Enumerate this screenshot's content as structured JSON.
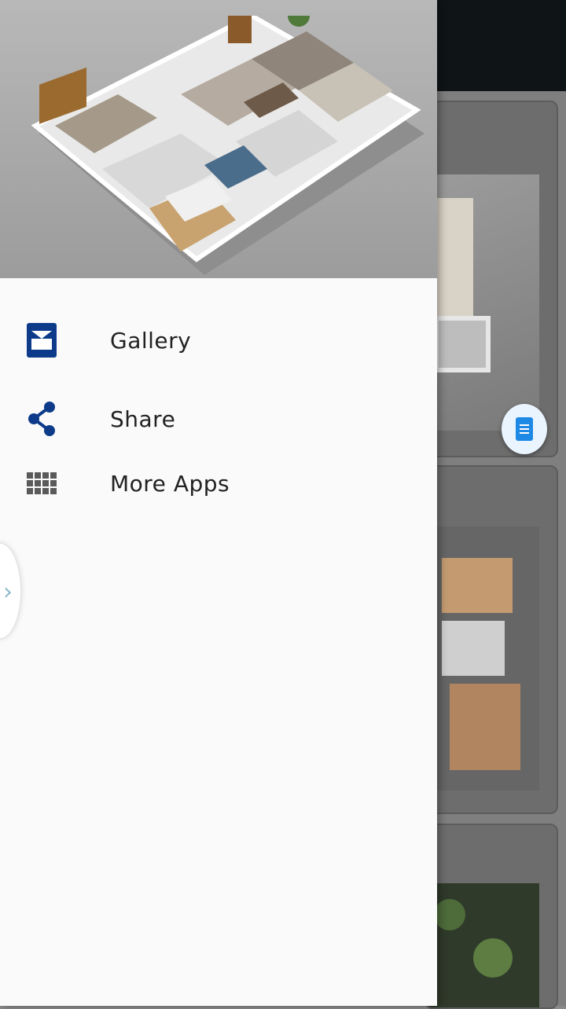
{
  "drawer": {
    "menu": [
      {
        "key": "gallery",
        "label": "Gallery",
        "icon": "gallery-icon"
      },
      {
        "key": "share",
        "label": "Share",
        "icon": "share-icon"
      },
      {
        "key": "more_apps",
        "label": "More Apps",
        "icon": "apps-grid-icon"
      }
    ]
  },
  "colors": {
    "icon_accent": "#0d3b8a",
    "drawer_bg": "#fafafa",
    "topbar_bg": "#0f1416"
  }
}
